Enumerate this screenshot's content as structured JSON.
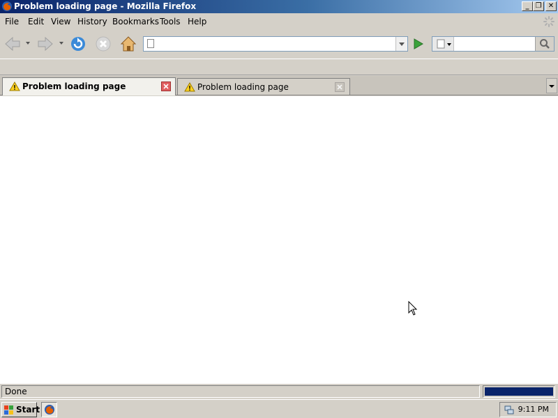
{
  "window": {
    "title": "Problem loading page - Mozilla Firefox",
    "controls": [
      "minimize",
      "restore",
      "close"
    ]
  },
  "menubar": {
    "items": [
      {
        "label": "File"
      },
      {
        "label": "Edit"
      },
      {
        "label": "View"
      },
      {
        "label": "History"
      },
      {
        "label": "Bookmarks"
      },
      {
        "label": "Tools"
      },
      {
        "label": "Help"
      }
    ]
  },
  "navbar": {
    "url_value": "",
    "search_value": "",
    "icons": [
      "back-icon",
      "forward-icon",
      "reload-icon",
      "stop-icon",
      "home-icon",
      "go-icon",
      "search-icon"
    ]
  },
  "tabs": [
    {
      "label": "Problem loading page",
      "active": true,
      "icon": "warning-icon"
    },
    {
      "label": "Problem loading page",
      "active": false,
      "icon": "warning-icon"
    }
  ],
  "statusbar": {
    "text": "Done",
    "progress": 1.0
  },
  "taskbar": {
    "start_label": "Start",
    "clock": "9:11 PM"
  },
  "colors": {
    "titlebar_start": "#0a246a",
    "titlebar_end": "#a6caf0",
    "progress_fill": "#0a246a",
    "chrome": "#d4d0c8"
  }
}
